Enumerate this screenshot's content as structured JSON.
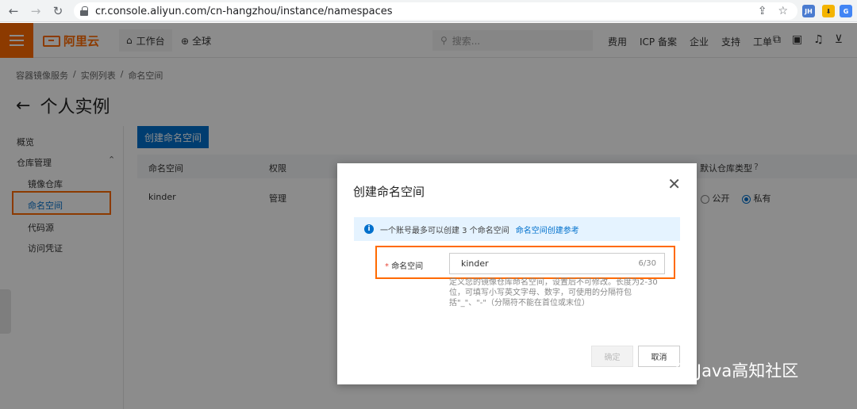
{
  "browser": {
    "url": "cr.console.aliyun.com/cn-hangzhou/instance/namespaces",
    "ext_jh": "JH",
    "ext_translate": "G"
  },
  "topbar": {
    "logo_text": "阿里云",
    "workbench": "工作台",
    "region": "全球",
    "search_placeholder": "搜索...",
    "links": [
      "费用",
      "ICP 备案",
      "企业",
      "支持",
      "工单"
    ]
  },
  "breadcrumb": [
    "容器镜像服务",
    "实例列表",
    "命名空间"
  ],
  "page_title": "个人实例",
  "sidebar": {
    "overview": "概览",
    "repo_mgmt": "仓库管理",
    "items": [
      "镜像仓库",
      "命名空间",
      "代码源",
      "访问凭证"
    ]
  },
  "main": {
    "create_button": "创建命名空间",
    "columns": [
      "命名空间",
      "权限",
      "默认仓库类型"
    ],
    "rows": [
      {
        "name": "kinder",
        "permission": "管理",
        "public": "公开",
        "private": "私有"
      }
    ]
  },
  "modal": {
    "title": "创建命名空间",
    "notice": "一个账号最多可以创建 3 个命名空间",
    "notice_link": "命名空间创建参考",
    "field_label": "命名空间",
    "field_required": "*",
    "field_value": "kinder",
    "counter": "6/30",
    "hint": "定义您的镜像仓库命名空间，设置后不可修改。长度为2-30位，可填写小写英文字母、数字，可使用的分隔符包括\"_\"、\"-\"（分隔符不能在首位或末位）",
    "ok_label": "确定",
    "cancel_label": "取消"
  },
  "watermark": "Java高知社区"
}
